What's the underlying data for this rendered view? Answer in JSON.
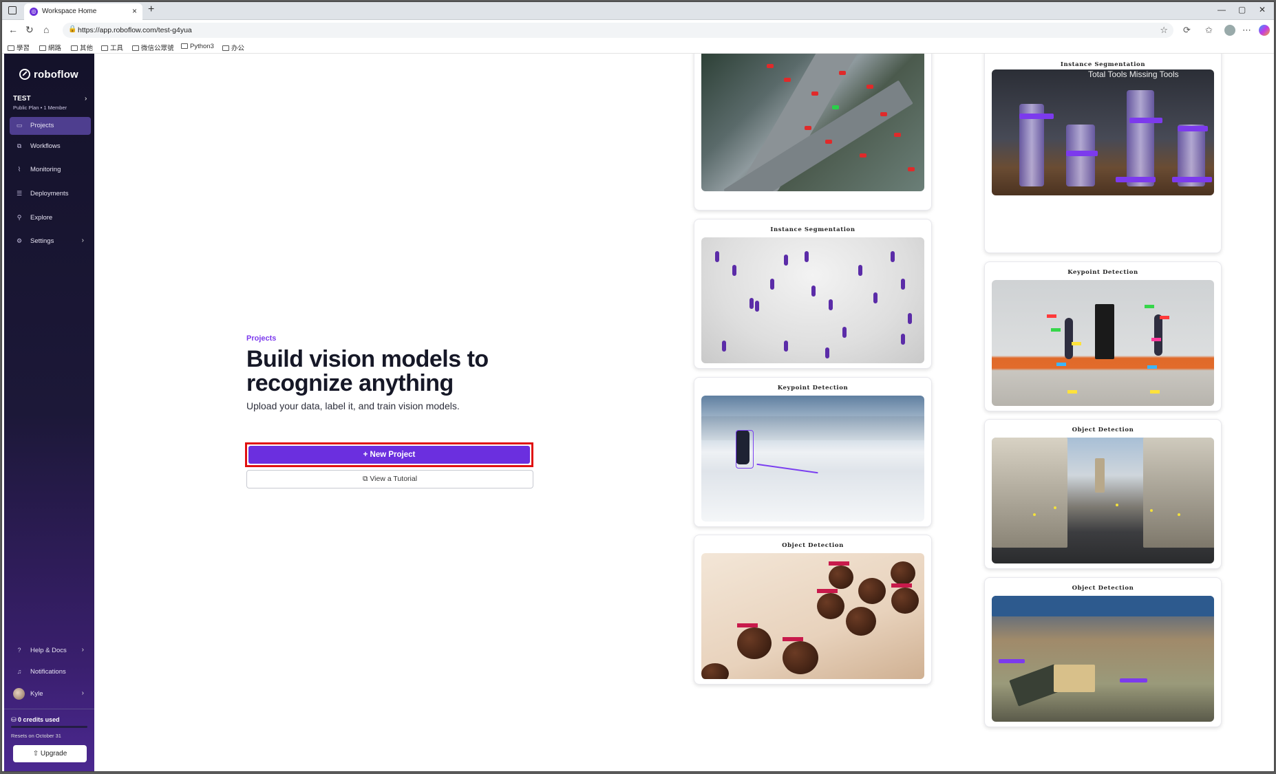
{
  "browser": {
    "tab_title": "Workspace Home",
    "tab_close": "×",
    "new_tab": "+",
    "url": "https://app.roboflow.com/test-g4yua",
    "window_controls": [
      "—",
      "▢",
      "✕"
    ],
    "bookmarks": [
      "學習",
      "網路",
      "其他",
      "工具",
      "微信公眾號",
      "Python3",
      "办公"
    ]
  },
  "sidebar": {
    "logo_text": "roboflow",
    "workspace_name": "TEST",
    "workspace_plan": "Public Plan • 1 Member",
    "nav": [
      {
        "label": "Projects",
        "icon": "projects-icon",
        "active": true
      },
      {
        "label": "Workflows",
        "icon": "workflows-icon"
      },
      {
        "label": "Monitoring",
        "icon": "monitoring-icon"
      },
      {
        "label": "Deployments",
        "icon": "deployments-icon"
      },
      {
        "label": "Explore",
        "icon": "explore-icon"
      },
      {
        "label": "Settings",
        "icon": "settings-icon"
      }
    ],
    "footer_nav": [
      {
        "label": "Help & Docs",
        "icon": "help-icon"
      },
      {
        "label": "Notifications",
        "icon": "bell-icon"
      },
      {
        "label": "Kyle",
        "icon": "avatar"
      }
    ],
    "credits_used": "0 credits used",
    "credits_reset": "Resets on October 31",
    "upgrade_label": "Upgrade"
  },
  "main": {
    "eyebrow": "Projects",
    "headline": "Build vision models to recognize anything",
    "subline": "Upload your data, label it, and train vision models.",
    "new_project_label": "+ New Project",
    "tutorial_label": "View a Tutorial"
  },
  "gallery": {
    "left": [
      {
        "title": "",
        "image": "aerial intersection with detected cars"
      },
      {
        "title": "Instance Segmentation",
        "image": "crowd of pedestrians"
      },
      {
        "title": "Keypoint Detection",
        "image": "skier on snowy slope"
      },
      {
        "title": "Object Detection",
        "image": "chocolate truffles on board"
      }
    ],
    "right": [
      {
        "title": "Instance Segmentation",
        "image": "tools with segmentation masks",
        "overlay": "Total Tools Missing Tools"
      },
      {
        "title": "Keypoint Detection",
        "image": "people walking in gym"
      },
      {
        "title": "Object Detection",
        "image": "city street scene"
      },
      {
        "title": "Object Detection",
        "image": "warehouse overhead view"
      }
    ]
  },
  "colors": {
    "accent": "#6b2fdf",
    "highlight_border": "#e01010",
    "sidebar_bg": "#1c1838"
  }
}
